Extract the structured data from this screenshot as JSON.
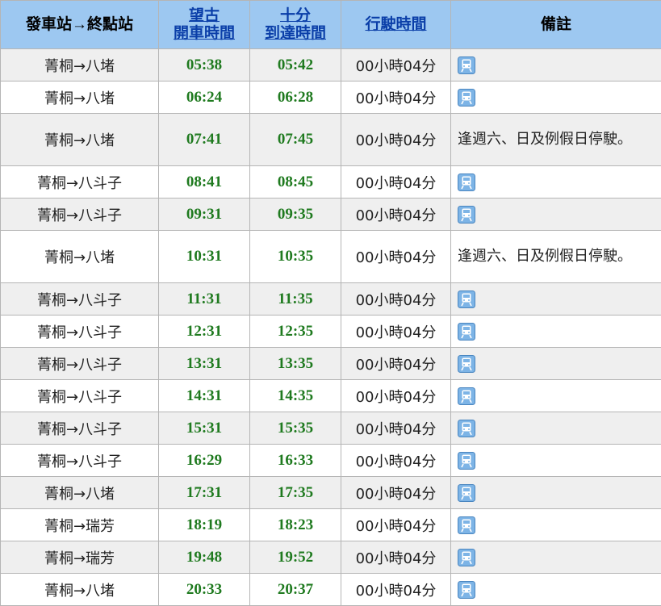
{
  "header": {
    "route": "發車站→終點站",
    "departure_line1": "望古",
    "departure_line2": "開車時間",
    "arrival_line1": "十分",
    "arrival_line2": "到達時間",
    "duration": "行駛時間",
    "remarks": "備註"
  },
  "colors": {
    "header_bg": "#9dc8f1",
    "time_green": "#1f7a1f",
    "link_blue": "#0a3ea8",
    "row_gray": "#efefef",
    "icon_blue": "#7db4e6"
  },
  "icon_name": "train-icon",
  "rows": [
    {
      "route": "菁桐→八堵",
      "depart": "05:38",
      "arrive": "05:42",
      "duration": "00小時04分",
      "remark": ""
    },
    {
      "route": "菁桐→八堵",
      "depart": "06:24",
      "arrive": "06:28",
      "duration": "00小時04分",
      "remark": ""
    },
    {
      "route": "菁桐→八堵",
      "depart": "07:41",
      "arrive": "07:45",
      "duration": "00小時04分",
      "remark": "逢週六、日及例假日停駛。"
    },
    {
      "route": "菁桐→八斗子",
      "depart": "08:41",
      "arrive": "08:45",
      "duration": "00小時04分",
      "remark": ""
    },
    {
      "route": "菁桐→八斗子",
      "depart": "09:31",
      "arrive": "09:35",
      "duration": "00小時04分",
      "remark": ""
    },
    {
      "route": "菁桐→八堵",
      "depart": "10:31",
      "arrive": "10:35",
      "duration": "00小時04分",
      "remark": "逢週六、日及例假日停駛。"
    },
    {
      "route": "菁桐→八斗子",
      "depart": "11:31",
      "arrive": "11:35",
      "duration": "00小時04分",
      "remark": ""
    },
    {
      "route": "菁桐→八斗子",
      "depart": "12:31",
      "arrive": "12:35",
      "duration": "00小時04分",
      "remark": ""
    },
    {
      "route": "菁桐→八斗子",
      "depart": "13:31",
      "arrive": "13:35",
      "duration": "00小時04分",
      "remark": ""
    },
    {
      "route": "菁桐→八斗子",
      "depart": "14:31",
      "arrive": "14:35",
      "duration": "00小時04分",
      "remark": ""
    },
    {
      "route": "菁桐→八斗子",
      "depart": "15:31",
      "arrive": "15:35",
      "duration": "00小時04分",
      "remark": ""
    },
    {
      "route": "菁桐→八斗子",
      "depart": "16:29",
      "arrive": "16:33",
      "duration": "00小時04分",
      "remark": ""
    },
    {
      "route": "菁桐→八堵",
      "depart": "17:31",
      "arrive": "17:35",
      "duration": "00小時04分",
      "remark": ""
    },
    {
      "route": "菁桐→瑞芳",
      "depart": "18:19",
      "arrive": "18:23",
      "duration": "00小時04分",
      "remark": ""
    },
    {
      "route": "菁桐→瑞芳",
      "depart": "19:48",
      "arrive": "19:52",
      "duration": "00小時04分",
      "remark": ""
    },
    {
      "route": "菁桐→八堵",
      "depart": "20:33",
      "arrive": "20:37",
      "duration": "00小時04分",
      "remark": ""
    }
  ]
}
